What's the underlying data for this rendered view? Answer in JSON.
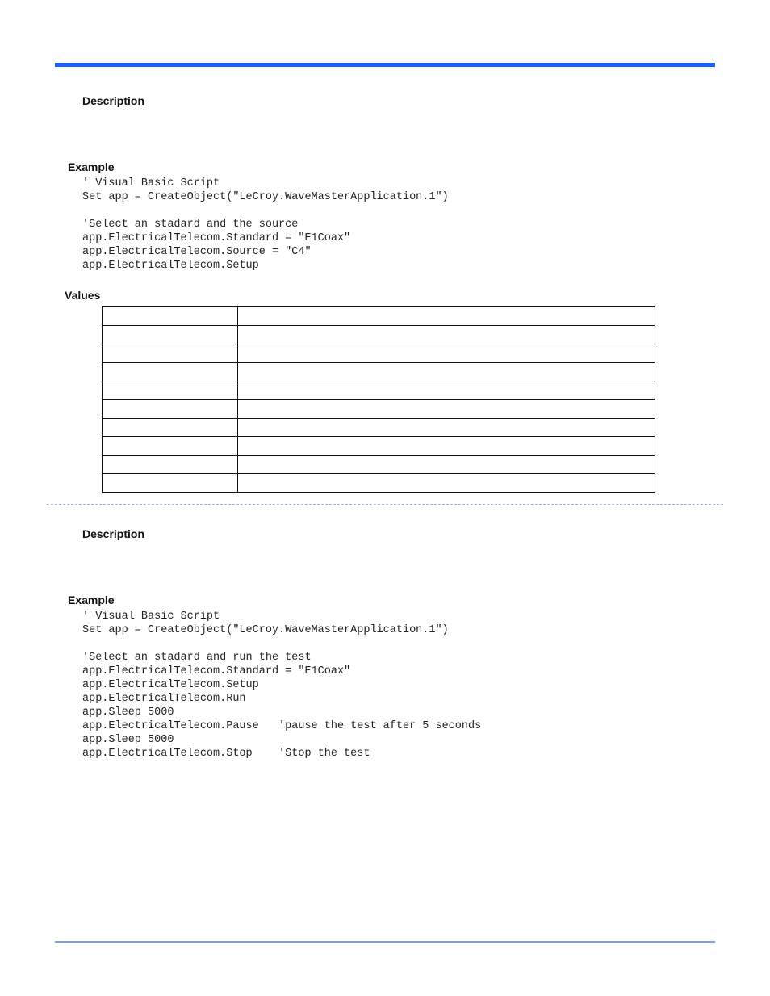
{
  "section1": {
    "heading_description": "Description",
    "heading_example": "Example",
    "code": "' Visual Basic Script\nSet app = CreateObject(\"LeCroy.WaveMasterApplication.1\")\n\n'Select an stadard and the source\napp.ElectricalTelecom.Standard = \"E1Coax\"\napp.ElectricalTelecom.Source = \"C4\"\napp.ElectricalTelecom.Setup",
    "heading_values": "Values",
    "values_rows": [
      [
        "",
        ""
      ],
      [
        "",
        ""
      ],
      [
        "",
        ""
      ],
      [
        "",
        ""
      ],
      [
        "",
        ""
      ],
      [
        "",
        ""
      ],
      [
        "",
        ""
      ],
      [
        "",
        ""
      ],
      [
        "",
        ""
      ],
      [
        "",
        ""
      ]
    ]
  },
  "section2": {
    "heading_description": "Description",
    "heading_example": "Example",
    "code": "' Visual Basic Script\nSet app = CreateObject(\"LeCroy.WaveMasterApplication.1\")\n\n'Select an stadard and run the test\napp.ElectricalTelecom.Standard = \"E1Coax\"\napp.ElectricalTelecom.Setup\napp.ElectricalTelecom.Run\napp.Sleep 5000\napp.ElectricalTelecom.Pause   'pause the test after 5 seconds\napp.Sleep 5000\napp.ElectricalTelecom.Stop    'Stop the test"
  }
}
